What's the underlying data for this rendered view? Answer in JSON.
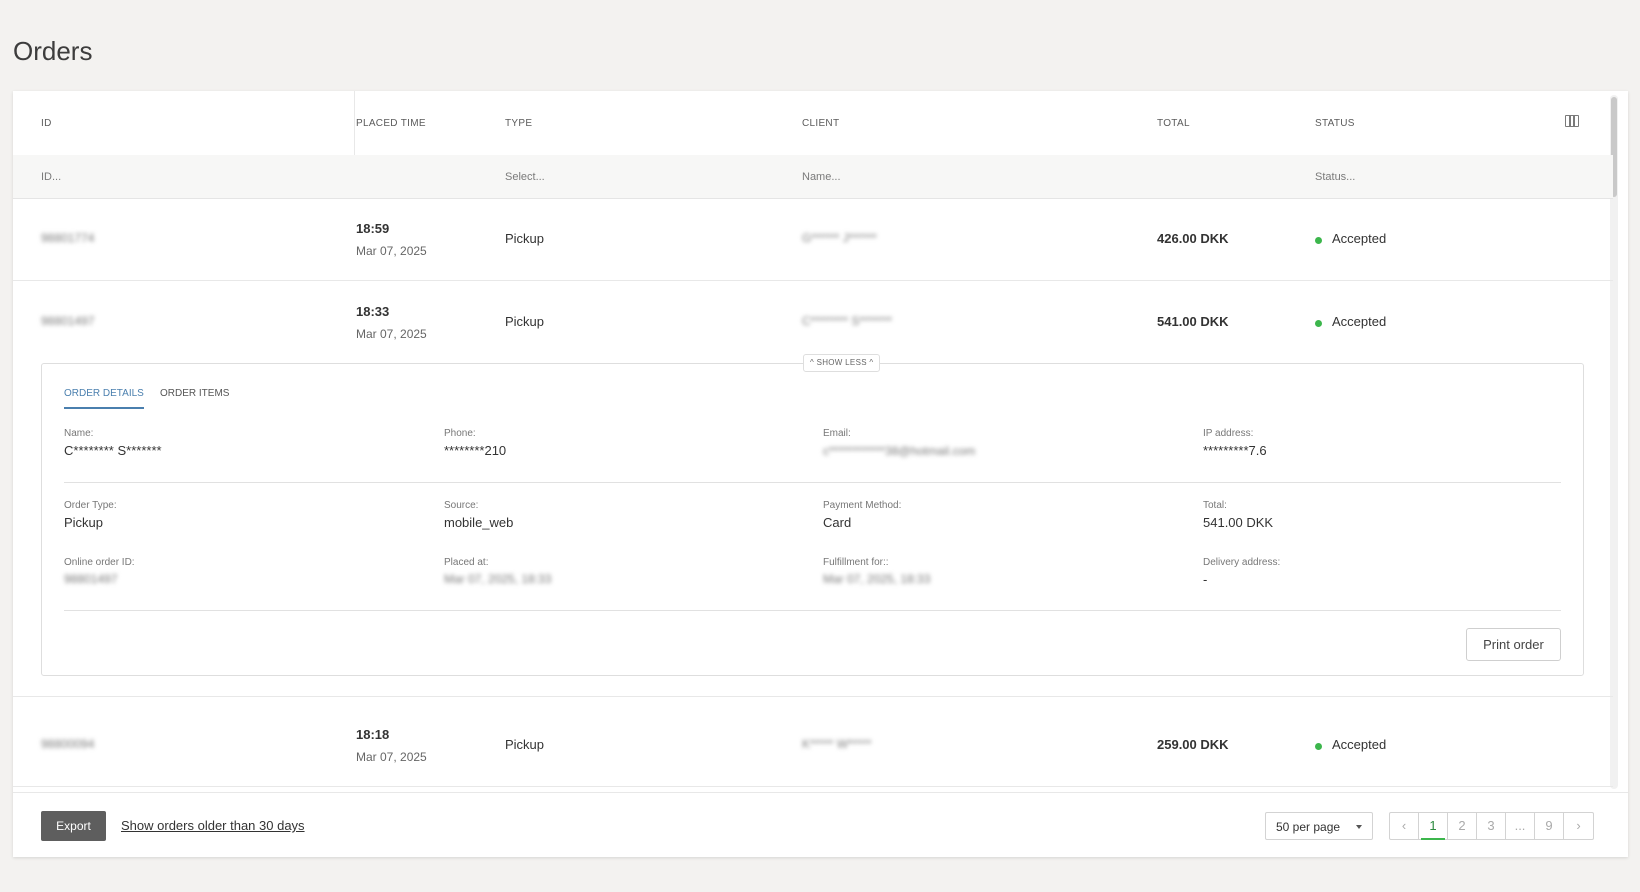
{
  "page": {
    "title": "Orders"
  },
  "table": {
    "headers": {
      "id": "ID",
      "placed_time": "PLACED TIME",
      "type": "TYPE",
      "client": "CLIENT",
      "total": "TOTAL",
      "status": "STATUS"
    },
    "filters": {
      "id_placeholder": "ID...",
      "type_placeholder": "Select...",
      "client_placeholder": "Name...",
      "status_placeholder": "Status..."
    },
    "rows": [
      {
        "id": "98801774",
        "time": "18:59",
        "date": "Mar 07, 2025",
        "type": "Pickup",
        "client": "G****** J******",
        "total": "426.00 DKK",
        "status": "Accepted"
      },
      {
        "id": "98801497",
        "time": "18:33",
        "date": "Mar 07, 2025",
        "type": "Pickup",
        "client": "C******** S*******",
        "total": "541.00 DKK",
        "status": "Accepted"
      },
      {
        "id": "98800094",
        "time": "18:18",
        "date": "Mar 07, 2025",
        "type": "Pickup",
        "client": "K***** W*****",
        "total": "259.00 DKK",
        "status": "Accepted"
      }
    ]
  },
  "detail": {
    "show_less": "^ SHOW LESS ^",
    "tabs": [
      "ORDER DETAILS",
      "ORDER ITEMS"
    ],
    "name_label": "Name:",
    "name": "C******** S*******",
    "phone_label": "Phone:",
    "phone": "********210",
    "email_label": "Email:",
    "email": "c************38@hotmail.com",
    "ip_label": "IP address:",
    "ip": "*********7.6",
    "order_type_label": "Order Type:",
    "order_type": "Pickup",
    "source_label": "Source:",
    "source": "mobile_web",
    "payment_label": "Payment Method:",
    "payment": "Card",
    "total_label": "Total:",
    "total": "541.00 DKK",
    "online_id_label": "Online order ID:",
    "online_id": "98801497",
    "placed_at_label": "Placed at:",
    "placed_at": "Mar 07, 2025, 18:33",
    "fulfillment_label": "Fulfillment for::",
    "fulfillment": "Mar 07, 2025, 18:33",
    "delivery_label": "Delivery address:",
    "delivery": "-",
    "print_button": "Print order"
  },
  "footer": {
    "export_button": "Export",
    "older_link": "Show orders older than 30 days",
    "per_page": "50 per page",
    "pages": [
      "1",
      "2",
      "3",
      "...",
      "9"
    ]
  },
  "colors": {
    "accent_tab": "#4a7fae",
    "status_green": "#3cb64c",
    "export_bg": "#5e5e5e"
  },
  "icons": {
    "columns": "columns-icon",
    "prev": "chevron-left-icon",
    "next": "chevron-right-icon"
  }
}
